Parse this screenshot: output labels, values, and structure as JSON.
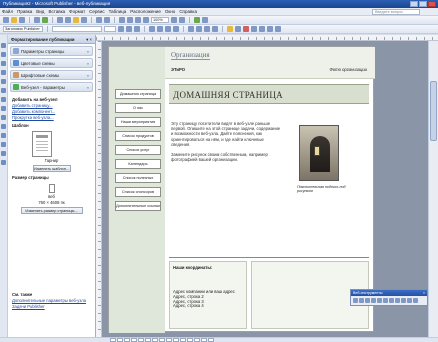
{
  "window": {
    "title": "Публикация2 - Microsoft Publisher - веб-публикация"
  },
  "menu": {
    "items": [
      "Файл",
      "Правка",
      "Вид",
      "Вставка",
      "Формат",
      "Сервис",
      "Таблица",
      "Расположение",
      "Окно",
      "Справка"
    ],
    "help_placeholder": "Введите вопрос"
  },
  "toolbar": {
    "zoom": "100%",
    "style_field": "Заголовок Publisher"
  },
  "task_pane": {
    "title": "Форматирование публикации",
    "sections": [
      {
        "label": "Параметры страницы"
      },
      {
        "label": "Цветовые схемы"
      },
      {
        "label": "Шрифтовые схемы"
      },
      {
        "label": "Веб-узел - параметры"
      }
    ],
    "add_heading": "Добавить на веб-узел",
    "add_links": [
      "Добавить страницу...",
      "Добавить компонент...",
      "Прокрутка веб-узла..."
    ],
    "template_label": "Шаблон",
    "template_name": "Гарнир",
    "change_template_button": "Изменить шаблон...",
    "page_size_heading": "Размер страницы",
    "page_size_name": "веб",
    "page_size_value": "760 × 4608 пк",
    "change_size_button": "Изменить размер страницы...",
    "see_also_heading": "См. также",
    "see_also_links": [
      "Дополнительные параметры веб-узла",
      "Задачи Publisher"
    ]
  },
  "page": {
    "org_name": "Организация",
    "logo_tag": "ЭТиРО",
    "logo_right": "Фото организации",
    "nav_buttons": [
      "Домашняя страница",
      "О нас",
      "Наши мероприятия",
      "Список продуктов",
      "Список услуг",
      "Календарь",
      "Список полезных",
      "Список спонсоров",
      "Дополнительные ссылки"
    ],
    "heading": "ДОМАШНЯЯ СТРАНИЦА",
    "body_p1": "Эту страницу посетители видят в веб-узле раньше первой. Опишите на этой странице задачи, содержание и возможности веб-узла. Дайте пояснения, как ориентироваться на нём, и где найти ключевые сведения.",
    "body_p2": "Замените рисунок своим собственным, например фотографией вашей организации.",
    "photo_caption": "Пояснительная подпись под рисунком",
    "contact_title": "Наши координаты:",
    "address_lines": [
      "Адрес компании или ваш адрес",
      "Адрес, строка 2",
      "Адрес, строка 3",
      "Адрес, строка 4"
    ]
  },
  "floating_toolbar": {
    "title": "Веб-инструменты"
  }
}
